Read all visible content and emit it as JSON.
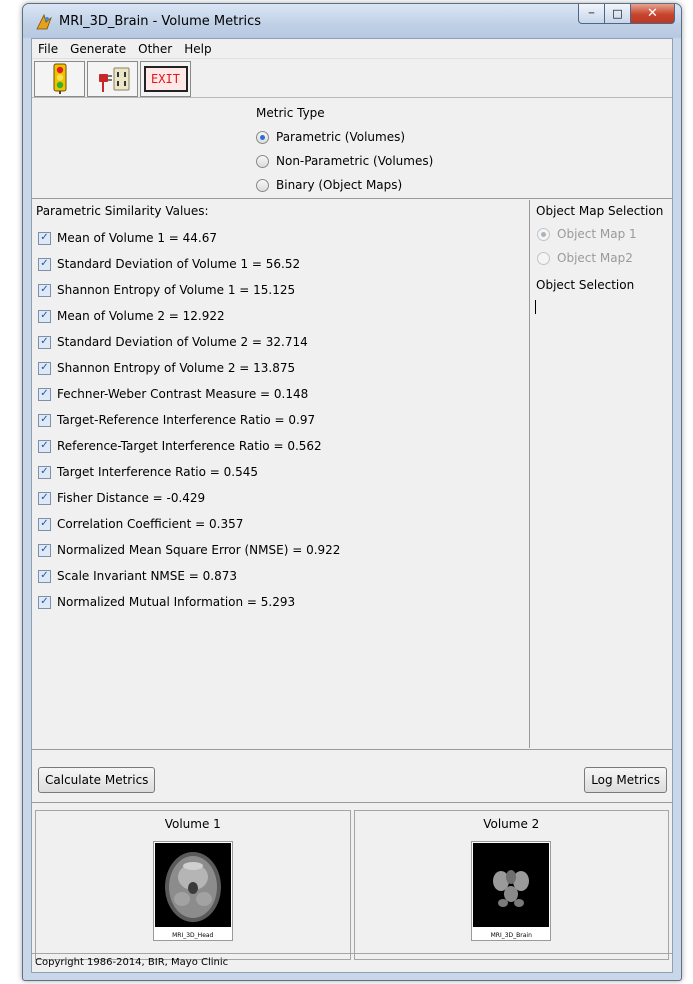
{
  "window": {
    "title": "MRI_3D_Brain - Volume Metrics",
    "min_glyph": "─",
    "max_glyph": "□",
    "close_glyph": "✕"
  },
  "menu": [
    "File",
    "Generate",
    "Other",
    "Help"
  ],
  "toolbar": {
    "buttons": [
      "traffic-light-icon",
      "plug-icon",
      "exit-icon"
    ],
    "exit_label": "EXIT"
  },
  "metric_type": {
    "title": "Metric Type",
    "options": [
      {
        "label": "Parametric (Volumes)",
        "selected": true
      },
      {
        "label": "Non-Parametric (Volumes)",
        "selected": false
      },
      {
        "label": "Binary (Object Maps)",
        "selected": false
      }
    ]
  },
  "values": {
    "title": "Parametric Similarity Values:",
    "items": [
      {
        "label": "Mean of Volume 1 = 44.67",
        "checked": true
      },
      {
        "label": "Standard Deviation of Volume 1 = 56.52",
        "checked": true
      },
      {
        "label": "Shannon Entropy of Volume 1 = 15.125",
        "checked": true
      },
      {
        "label": "Mean of Volume 2 = 12.922",
        "checked": true
      },
      {
        "label": "Standard Deviation of Volume 2 = 32.714",
        "checked": true
      },
      {
        "label": "Shannon Entropy of Volume 2 = 13.875",
        "checked": true
      },
      {
        "label": "Fechner-Weber Contrast Measure = 0.148",
        "checked": true
      },
      {
        "label": "Target-Reference Interference Ratio = 0.97",
        "checked": true
      },
      {
        "label": "Reference-Target Interference Ratio = 0.562",
        "checked": true
      },
      {
        "label": "Target Interference Ratio = 0.545",
        "checked": true
      },
      {
        "label": "Fisher Distance = -0.429",
        "checked": true
      },
      {
        "label": "Correlation Coefficient = 0.357",
        "checked": true
      },
      {
        "label": "Normalized Mean Square Error (NMSE) = 0.922",
        "checked": true
      },
      {
        "label": "Scale Invariant NMSE = 0.873",
        "checked": true
      },
      {
        "label": "Normalized Mutual Information = 5.293",
        "checked": true
      }
    ]
  },
  "object_map": {
    "title": "Object Map Selection",
    "options": [
      {
        "label": "Object Map 1",
        "selected": true
      },
      {
        "label": "Object Map2",
        "selected": false
      }
    ],
    "selection_label": "Object Selection"
  },
  "buttons": {
    "calculate": "Calculate Metrics",
    "log": "Log Metrics"
  },
  "volumes": [
    {
      "title": "Volume 1",
      "name": "MRI_3D_Head"
    },
    {
      "title": "Volume 2",
      "name": "MRI_3D_Brain"
    }
  ],
  "status": "Copyright 1986-2014, BIR, Mayo Clinic"
}
